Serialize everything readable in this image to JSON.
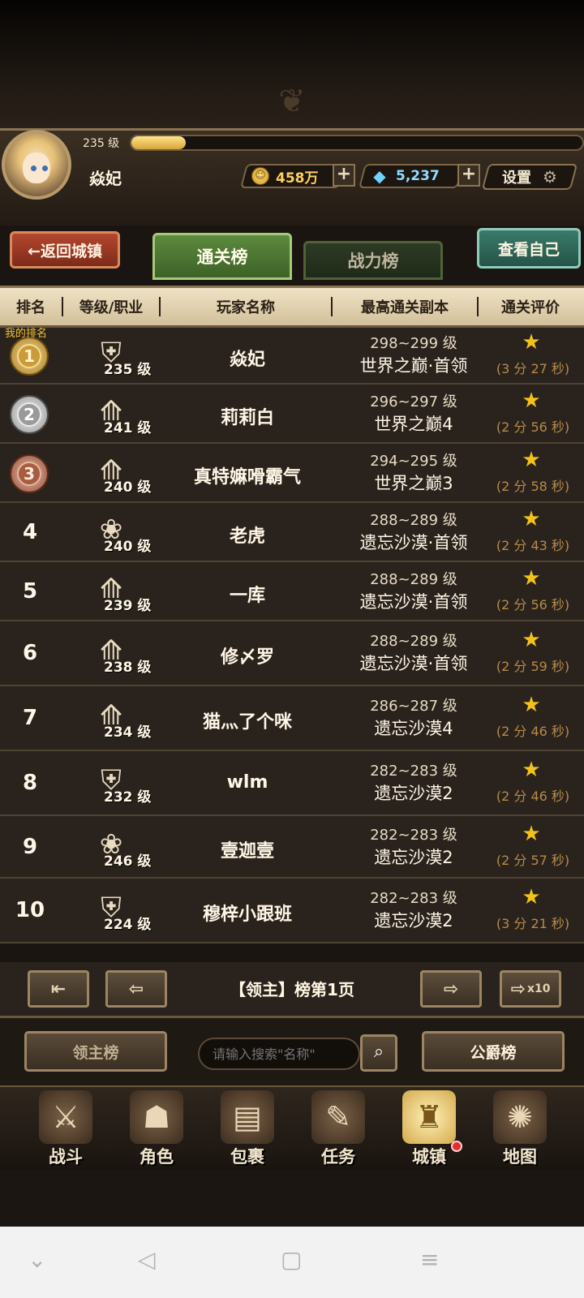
{
  "header": {
    "level": "235 级",
    "player_name": "焱妃",
    "gold": "458万",
    "gems": "5,237",
    "settings_label": "设置",
    "xp_progress": 0.12
  },
  "nav": {
    "back_label": "←返回城镇",
    "tabs": [
      {
        "label": "通关榜",
        "active": true
      },
      {
        "label": "战力榜",
        "active": false
      }
    ],
    "view_self_label": "查看自己"
  },
  "columns": {
    "rank": "排名",
    "level_class": "等级/职业",
    "player_name": "玩家名称",
    "best_dungeon": "最高通关副本",
    "rating": "通关评价"
  },
  "my_rank_label": "我的排名",
  "rows": [
    {
      "rank": "1",
      "level": "235 级",
      "class_icon": "helmet-icon",
      "name": "焱妃",
      "dungeon_level": "298~299 级",
      "dungeon": "世界之巅·首领",
      "time": "(3 分 27 秒)"
    },
    {
      "rank": "2",
      "level": "241 级",
      "class_icon": "flame-icon",
      "name": "莉莉白",
      "dungeon_level": "296~297 级",
      "dungeon": "世界之巅4",
      "time": "(2 分 56 秒)"
    },
    {
      "rank": "3",
      "level": "240 级",
      "class_icon": "flame-icon",
      "name": "真特嫲嗗霸气",
      "dungeon_level": "294~295 级",
      "dungeon": "世界之巅3",
      "time": "(2 分 58 秒)"
    },
    {
      "rank": "4",
      "level": "240 级",
      "class_icon": "paw-icon",
      "name": "老虎",
      "dungeon_level": "288~289 级",
      "dungeon": "遗忘沙漠·首领",
      "time": "(2 分 43 秒)"
    },
    {
      "rank": "5",
      "level": "239 级",
      "class_icon": "flame-icon",
      "name": "一库",
      "dungeon_level": "288~289 级",
      "dungeon": "遗忘沙漠·首领",
      "time": "(2 分 56 秒)"
    },
    {
      "rank": "6",
      "level": "238 级",
      "class_icon": "flame-icon",
      "name": "修〆罗",
      "dungeon_level": "288~289 级",
      "dungeon": "遗忘沙漠·首领",
      "time": "(2 分 59 秒)"
    },
    {
      "rank": "7",
      "level": "234 级",
      "class_icon": "flame-icon",
      "name": "猫灬了个咪",
      "dungeon_level": "286~287 级",
      "dungeon": "遗忘沙漠4",
      "time": "(2 分 46 秒)"
    },
    {
      "rank": "8",
      "level": "232 级",
      "class_icon": "helmet-icon",
      "name": "wlm",
      "dungeon_level": "282~283 级",
      "dungeon": "遗忘沙漠2",
      "time": "(2 分 46 秒)"
    },
    {
      "rank": "9",
      "level": "246 级",
      "class_icon": "paw-icon",
      "name": "壹迦壹",
      "dungeon_level": "282~283 级",
      "dungeon": "遗忘沙漠2",
      "time": "(2 分 57 秒)"
    },
    {
      "rank": "10",
      "level": "224 级",
      "class_icon": "helmet-icon",
      "name": "穆梓小跟班",
      "dungeon_level": "282~283 级",
      "dungeon": "遗忘沙漠2",
      "time": "(3 分 21 秒)"
    }
  ],
  "pager": {
    "page_label": "【领主】榜第1页",
    "x10_label": "x10"
  },
  "search": {
    "lord_label": "领主榜",
    "placeholder": "请输入搜索\"名称\"",
    "duke_label": "公爵榜"
  },
  "menu": [
    {
      "label": "战斗",
      "icon": "battle-icon"
    },
    {
      "label": "角色",
      "icon": "character-icon"
    },
    {
      "label": "包裹",
      "icon": "bag-icon"
    },
    {
      "label": "任务",
      "icon": "quest-icon"
    },
    {
      "label": "城镇",
      "icon": "town-icon",
      "active": true
    },
    {
      "label": "地图",
      "icon": "map-icon"
    }
  ]
}
